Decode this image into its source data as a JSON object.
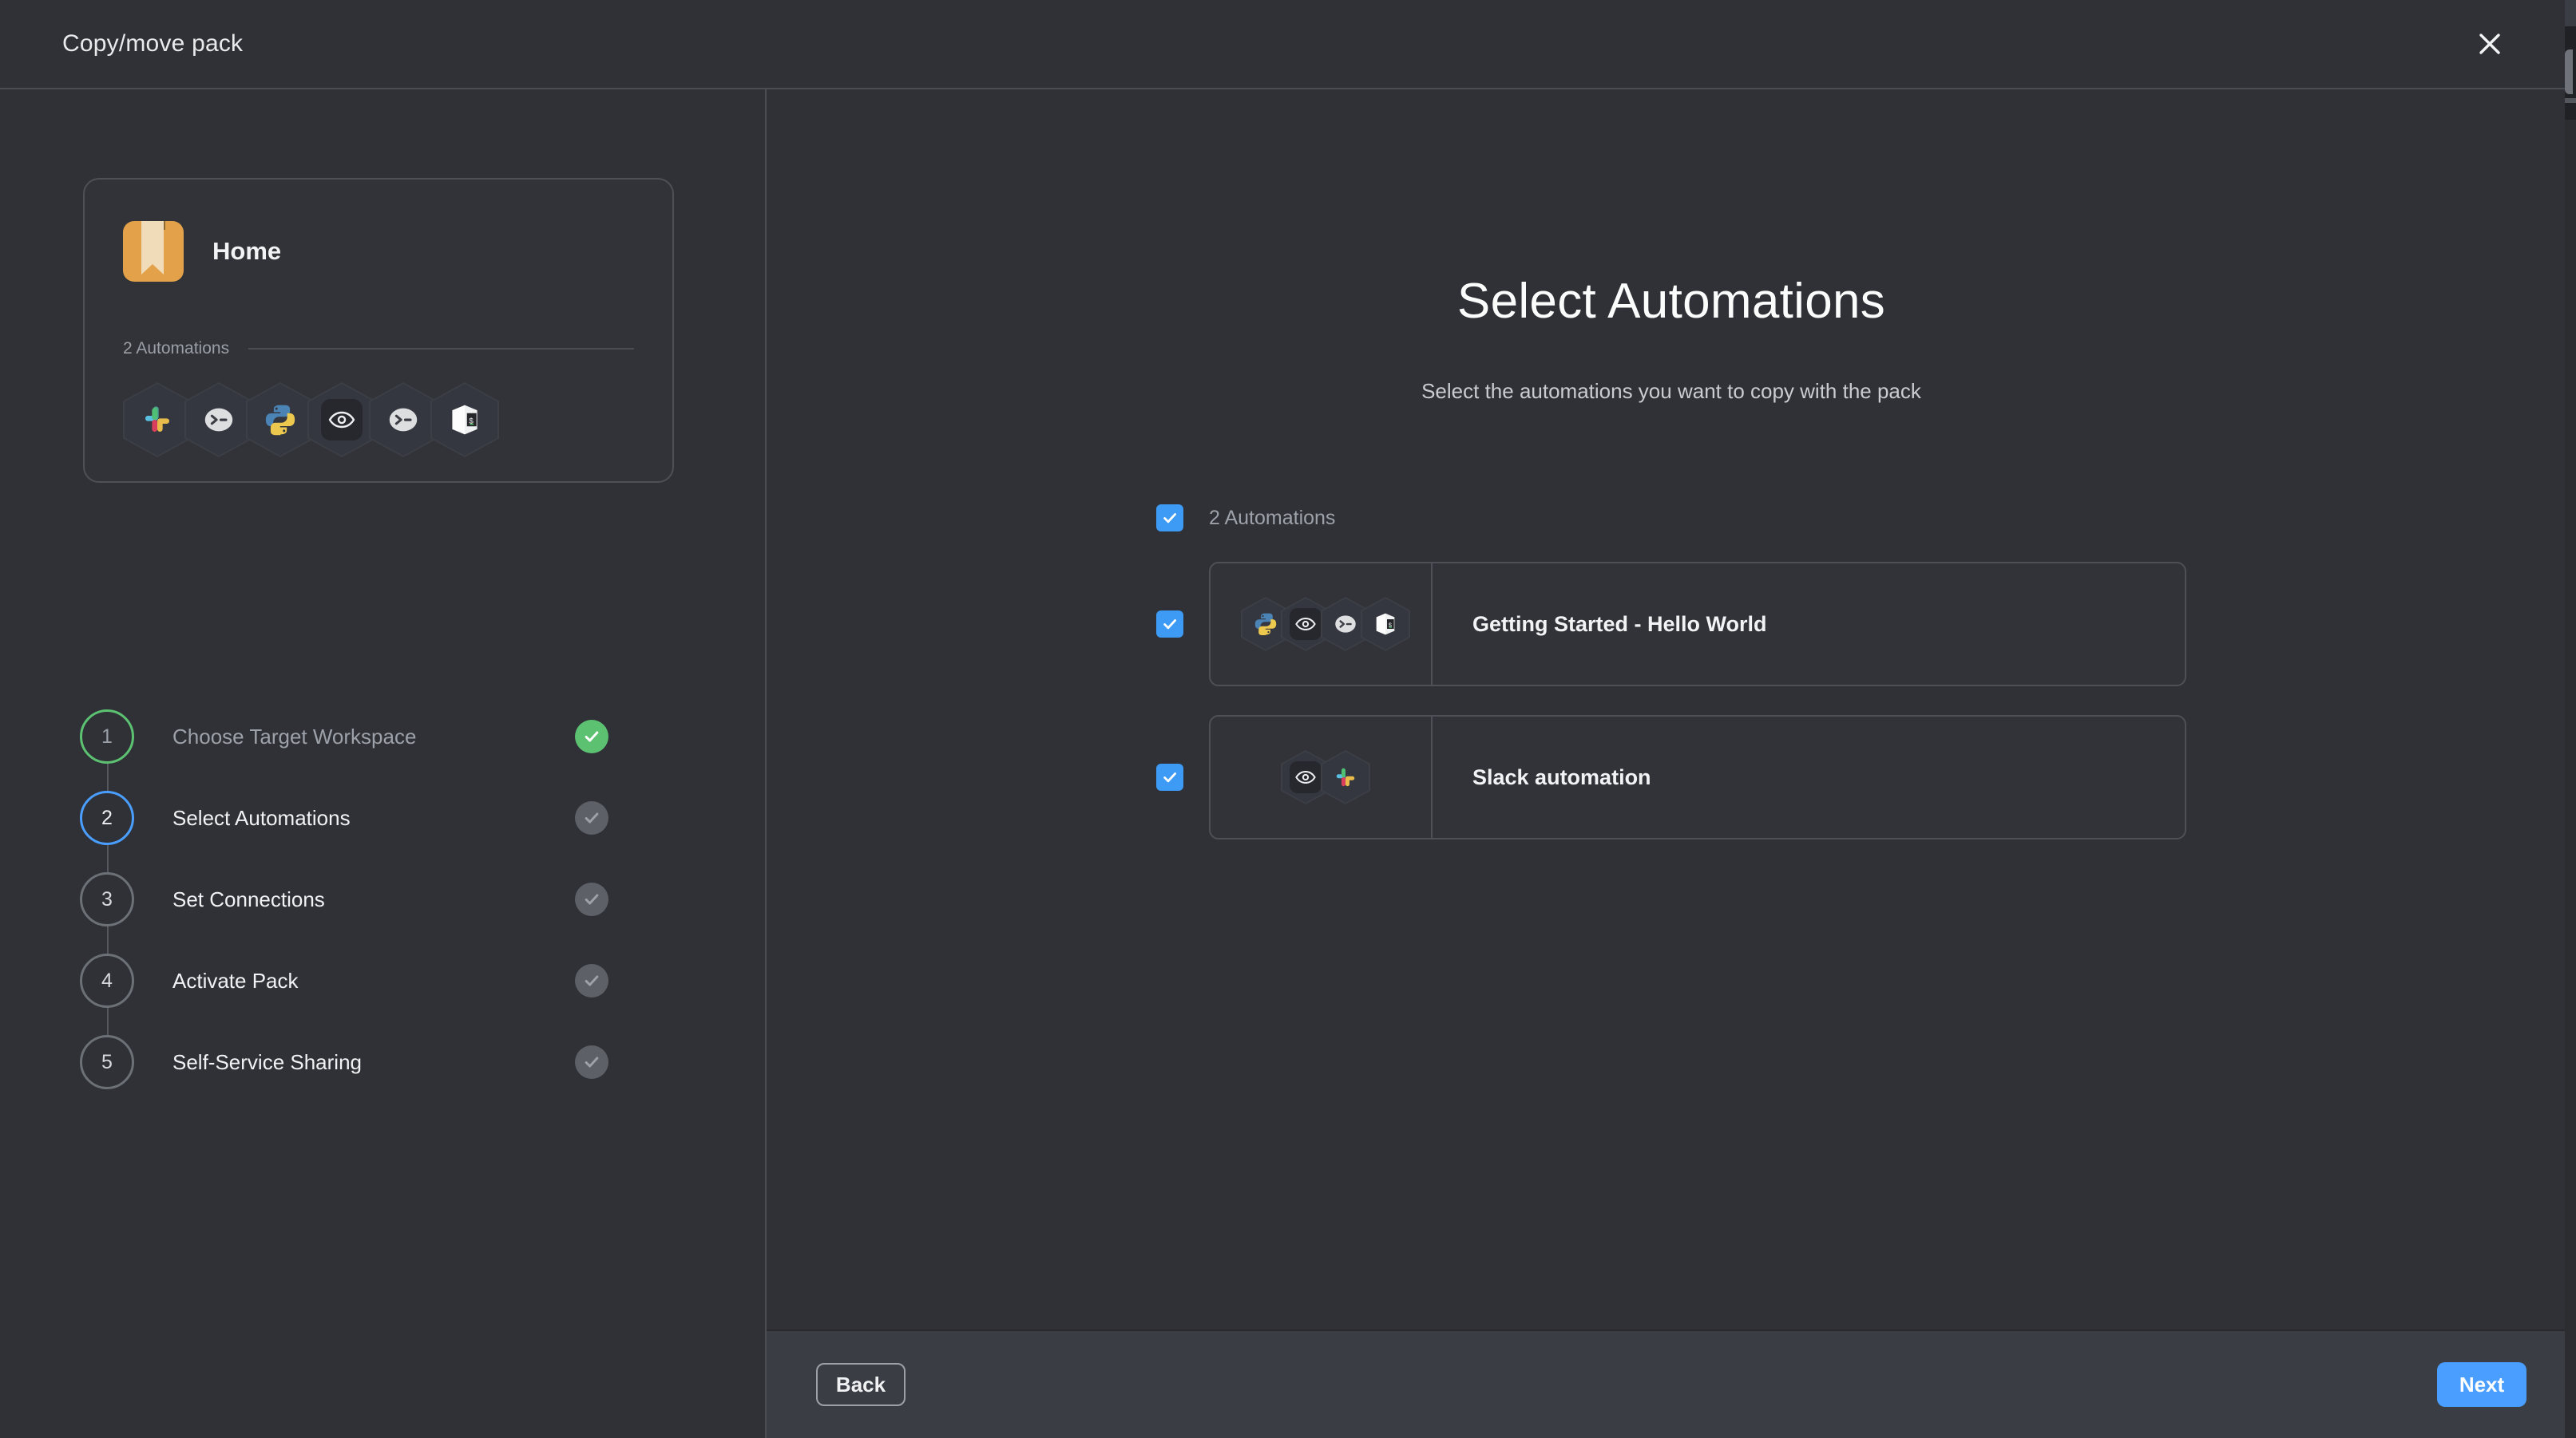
{
  "window": {
    "title": "Copy/move pack",
    "close_icon": "close-icon"
  },
  "pack": {
    "icon": "folder-icon",
    "name": "Home",
    "automations_label": "2 Automations",
    "integration_icons": [
      "slack-icon",
      "bot-terminal-icon",
      "python-icon",
      "eye-icon",
      "bot-terminal-icon",
      "cube-shell-icon"
    ]
  },
  "stepper": {
    "steps": [
      {
        "number": "1",
        "label": "Choose Target Workspace",
        "state": "done",
        "check_icon": "check-icon"
      },
      {
        "number": "2",
        "label": "Select Automations",
        "state": "active",
        "check_icon": "check-icon"
      },
      {
        "number": "3",
        "label": "Set Connections",
        "state": "pending",
        "check_icon": "check-icon"
      },
      {
        "number": "4",
        "label": "Activate Pack",
        "state": "pending",
        "check_icon": "check-icon"
      },
      {
        "number": "5",
        "label": "Self-Service Sharing",
        "state": "pending",
        "check_icon": "check-icon"
      }
    ]
  },
  "main": {
    "title": "Select Automations",
    "subtitle": "Select the automations you want to copy with the pack",
    "select_all": {
      "label": "2 Automations",
      "checked": true,
      "checkbox_icon": "checkbox-checked-icon"
    },
    "automations": [
      {
        "name": "Getting Started - Hello World",
        "checked": true,
        "icons": [
          "python-icon",
          "eye-icon",
          "bot-terminal-icon",
          "cube-shell-icon"
        ]
      },
      {
        "name": "Slack automation",
        "checked": true,
        "icons": [
          "eye-icon",
          "slack-icon"
        ]
      }
    ]
  },
  "footer": {
    "back_label": "Back",
    "next_label": "Next"
  },
  "colors": {
    "background": "#2f3136",
    "card": "#313338",
    "border": "#4d5057",
    "accent_blue": "#4a9eff",
    "checkbox_blue": "#3d9bf5",
    "success_green": "#5cc272",
    "footer": "#3a3d44",
    "folder_orange": "#e3a14a",
    "text_primary": "#f2f3f5",
    "text_muted": "#9da1a9"
  }
}
